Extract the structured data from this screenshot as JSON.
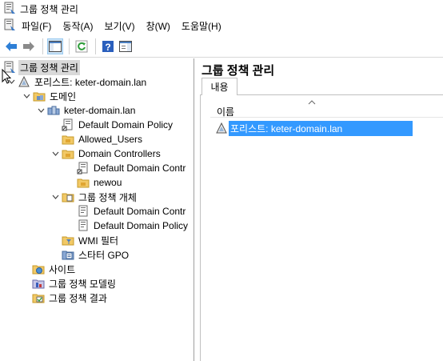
{
  "window": {
    "title": "그룹 정책 관리"
  },
  "menu": [
    "파일(F)",
    "동작(A)",
    "보기(V)",
    "창(W)",
    "도움말(H)"
  ],
  "tree": {
    "root": "그룹 정책 관리",
    "forest": "포리스트: keter-domain.lan",
    "domains": "도메인",
    "domain": "keter-domain.lan",
    "default_domain_policy": "Default Domain Policy",
    "allowed_users": "Allowed_Users",
    "domain_controllers": "Domain Controllers",
    "dc_default_policy": "Default Domain Contr",
    "newou": "newou",
    "gpo_objects": "그룹 정책 개체",
    "gpo_default_controllers": "Default Domain Contr",
    "gpo_default_domain_policy": "Default Domain Policy",
    "wmi_filters": "WMI 필터",
    "starter_gpos": "스타터 GPO",
    "sites": "사이트",
    "gp_modeling": "그룹 정책 모델링",
    "gp_results": "그룹 정책 결과"
  },
  "right": {
    "header": "그룹 정책 관리",
    "tab_label": "내용",
    "column_name": "이름",
    "items": [
      "포리스트: keter-domain.lan"
    ]
  }
}
